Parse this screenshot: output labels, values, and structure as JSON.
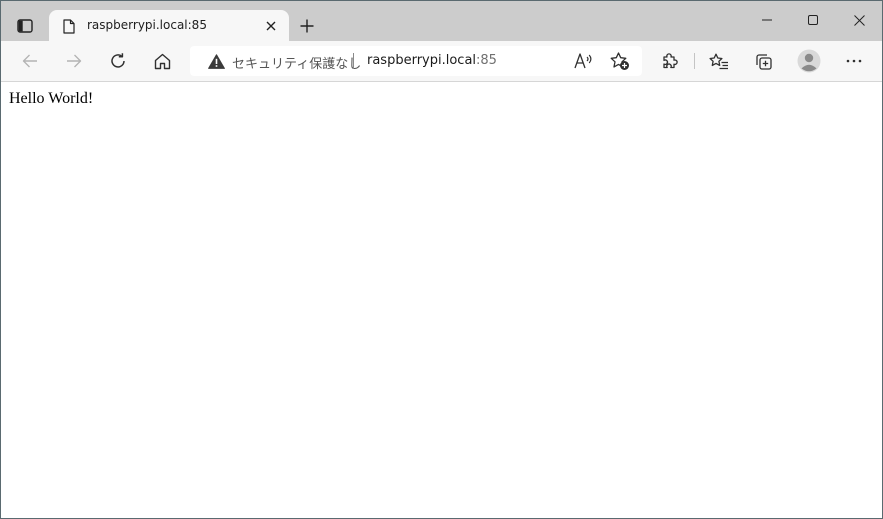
{
  "tab": {
    "title": "raspberrypi.local:85"
  },
  "address_bar": {
    "security_label": "セキュリティ保護なし",
    "url_host": "raspberrypi.local",
    "url_port": ":85"
  },
  "page": {
    "body_text": "Hello World!"
  },
  "icons": {
    "tab_actions": "tab-actions-icon",
    "favicon": "page-icon",
    "tab_close": "close-icon",
    "new_tab": "plus-icon",
    "back": "arrow-left-icon",
    "forward": "arrow-right-icon",
    "refresh": "refresh-icon",
    "home": "home-icon",
    "warning": "warning-triangle-icon",
    "read_aloud": "read-aloud-icon",
    "add_favorite": "star-plus-icon",
    "extensions": "puzzle-icon",
    "favorites": "favorites-list-icon",
    "collections": "collections-icon",
    "profile": "avatar-icon",
    "menu": "more-icon",
    "minimize": "minimize-icon",
    "maximize": "maximize-icon",
    "close_window": "close-window-icon"
  },
  "colors": {
    "titlebar_bg": "#cccccc",
    "toolbar_bg": "#f7f7f7",
    "disabled_icon": "#b4b4b4",
    "icon": "#303030"
  }
}
